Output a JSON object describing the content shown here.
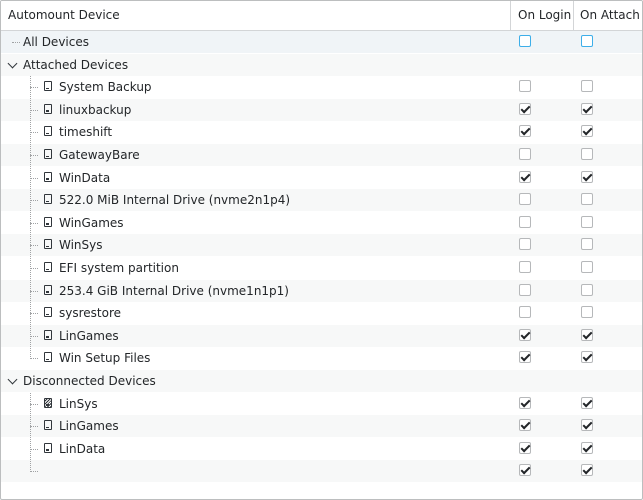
{
  "header": {
    "col_device": "Automount Device",
    "col_login": "On Login",
    "col_attach": "On Attach"
  },
  "all_devices": {
    "label": "All Devices",
    "on_login": false,
    "on_attach": false
  },
  "attached": {
    "label": "Attached Devices",
    "items": [
      {
        "label": "System Backup",
        "on_login": false,
        "on_attach": false
      },
      {
        "label": "linuxbackup",
        "on_login": true,
        "on_attach": true
      },
      {
        "label": "timeshift",
        "on_login": true,
        "on_attach": true
      },
      {
        "label": "GatewayBare",
        "on_login": false,
        "on_attach": false
      },
      {
        "label": "WinData",
        "on_login": true,
        "on_attach": true
      },
      {
        "label": "522.0 MiB Internal Drive (nvme2n1p4)",
        "on_login": false,
        "on_attach": false
      },
      {
        "label": "WinGames",
        "on_login": false,
        "on_attach": false
      },
      {
        "label": "WinSys",
        "on_login": false,
        "on_attach": false
      },
      {
        "label": "EFI system partition",
        "on_login": false,
        "on_attach": false
      },
      {
        "label": "253.4 GiB Internal Drive (nvme1n1p1)",
        "on_login": false,
        "on_attach": false
      },
      {
        "label": "sysrestore",
        "on_login": false,
        "on_attach": false
      },
      {
        "label": "LinGames",
        "on_login": true,
        "on_attach": true
      },
      {
        "label": "Win Setup Files",
        "on_login": true,
        "on_attach": true
      }
    ]
  },
  "disconnected": {
    "label": "Disconnected Devices",
    "items": [
      {
        "label": "LinSys",
        "on_login": true,
        "on_attach": true,
        "icon": "drive-disconnected-icon"
      },
      {
        "label": "LinGames",
        "on_login": true,
        "on_attach": true,
        "icon": "drive-icon"
      },
      {
        "label": "LinData",
        "on_login": true,
        "on_attach": true,
        "icon": "drive-icon"
      },
      {
        "label": "",
        "on_login": true,
        "on_attach": true,
        "icon": ""
      }
    ]
  },
  "colors": {
    "focus": "#3daee9",
    "text": "#232629",
    "selected_row": "#f0f4f7"
  }
}
